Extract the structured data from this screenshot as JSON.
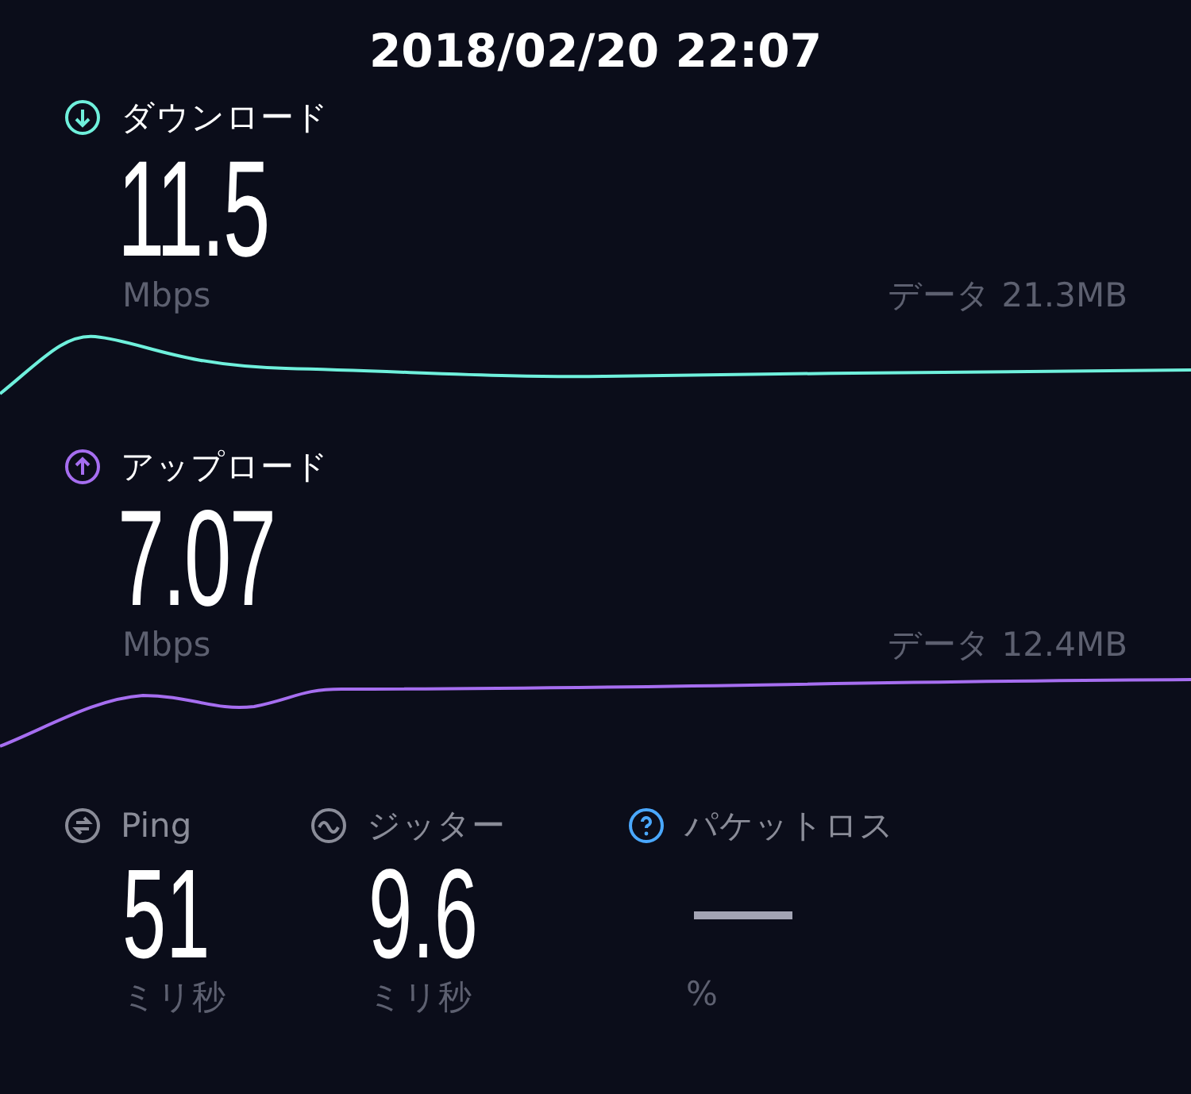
{
  "timestamp": "2018/02/20 22:07",
  "speeds": [
    {
      "kind": "download",
      "label": "ダウンロード",
      "value": "11.5",
      "unit": "Mbps",
      "data": "データ 21.3MB",
      "color": "#6ff0dc"
    },
    {
      "kind": "upload",
      "label": "アップロード",
      "value": "7.07",
      "unit": "Mbps",
      "data": "データ 12.4MB",
      "color": "#a66ef0"
    }
  ],
  "metrics": [
    {
      "kind": "ping",
      "label": "Ping",
      "value": "51",
      "unit": "ミリ秒"
    },
    {
      "kind": "jitter",
      "label": "ジッター",
      "value": "9.6",
      "unit": "ミリ秒"
    },
    {
      "kind": "loss",
      "label": "パケットロス",
      "unit": "%"
    }
  ]
}
